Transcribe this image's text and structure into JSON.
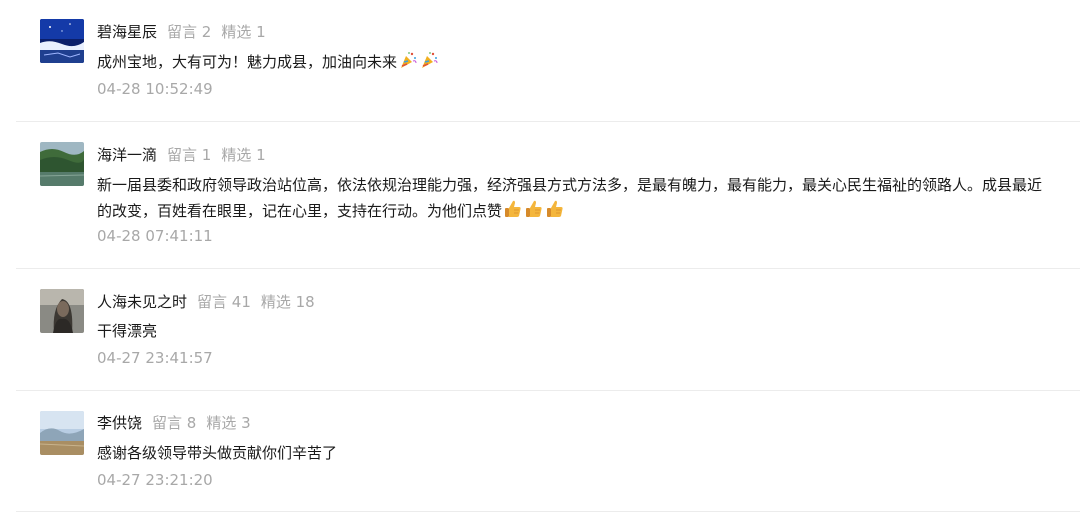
{
  "comments": [
    {
      "nickname": "碧海星辰",
      "messages_label": "留言 2",
      "featured_label": "精选 1",
      "text": "成州宝地，大有可为！魅力成县，加油向未来",
      "emojis": [
        "party-popper-icon",
        "party-popper-icon"
      ],
      "time": "04-28 10:52:49"
    },
    {
      "nickname": "海洋一滴",
      "messages_label": "留言 1",
      "featured_label": "精选 1",
      "text": "新一届县委和政府领导政治站位高，依法依规治理能力强，经济强县方式方法多，是最有魄力，最有能力，最关心民生福祉的领路人。成县最近的改变，百姓看在眼里，记在心里，支持在行动。为他们点赞",
      "emojis": [
        "thumbs-up-icon",
        "thumbs-up-icon",
        "thumbs-up-icon"
      ],
      "time": "04-28 07:41:11"
    },
    {
      "nickname": "人海未见之时",
      "messages_label": "留言 41",
      "featured_label": "精选 18",
      "text": "干得漂亮",
      "emojis": [],
      "time": "04-27 23:41:57"
    },
    {
      "nickname": "李供饶",
      "messages_label": "留言 8",
      "featured_label": "精选 3",
      "text": "感谢各级领导带头做贡献你们辛苦了",
      "emojis": [],
      "time": "04-27 23:21:20"
    }
  ]
}
